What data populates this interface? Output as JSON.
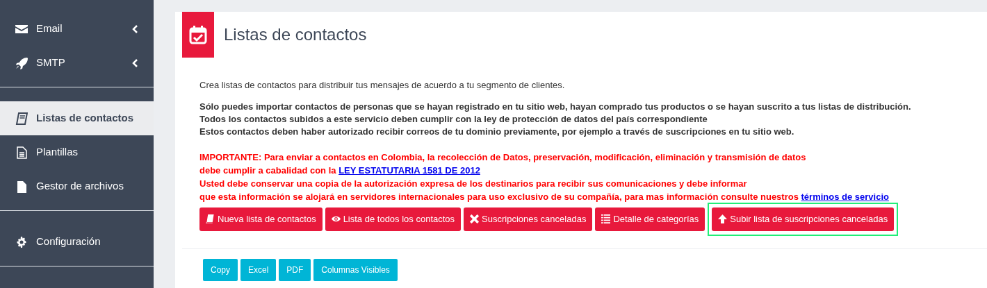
{
  "sidebar": {
    "groups": [
      {
        "items": [
          {
            "label": "Email",
            "selected": false,
            "expandable": true
          },
          {
            "label": "SMTP",
            "selected": false,
            "expandable": true
          }
        ]
      },
      {
        "items": [
          {
            "label": "Listas de contactos",
            "selected": true,
            "expandable": false
          },
          {
            "label": "Plantillas",
            "selected": false,
            "expandable": false
          },
          {
            "label": "Gestor de archivos",
            "selected": false,
            "expandable": false
          }
        ]
      },
      {
        "items": [
          {
            "label": "Configuración",
            "selected": false,
            "expandable": false
          }
        ]
      }
    ]
  },
  "page": {
    "title": "Listas de contactos",
    "intro": "Crea listas de contactos para distribuir tus mensajes de acuerdo a tu segmento de clientes.",
    "rules": [
      "Sólo puedes importar contactos de personas que se hayan registrado en tu sitio web, hayan comprado tus productos o se hayan suscrito a tus listas de distribución.",
      "Todos los contactos subidos a este servicio deben cumplir con la ley de protección de datos del país correspondiente",
      "Estos contactos deben haber autorizado recibir correos de tu dominio previamente, por ejemplo a través de suscripciones en tu sitio web."
    ],
    "notice": [
      [
        {
          "kind": "text",
          "text": "IMPORTANTE: Para enviar a contactos en Colombia, la recolección de Datos, preservación, modificación, eliminación y transmisión de datos"
        }
      ],
      [
        {
          "kind": "text",
          "text": "debe cumplir a cabalidad con la "
        },
        {
          "kind": "link",
          "text": "LEY ESTATUTARIA 1581 DE 2012"
        }
      ],
      [
        {
          "kind": "text",
          "text": "Usted debe conservar una copia de la autorización expresa de los destinarios para recibir sus comunicaciones y debe informar"
        }
      ],
      [
        {
          "kind": "text",
          "text": "que esta información se alojará en servidores internacionales para uso exclusivo de su compañía, para mas información consulte nuestros "
        },
        {
          "kind": "link",
          "text": "términos de servicio"
        }
      ]
    ],
    "actions": [
      {
        "label": "Nueva lista de contactos",
        "highlighted": false
      },
      {
        "label": "Lista de todos los contactos",
        "highlighted": false
      },
      {
        "label": "Suscripciones canceladas",
        "highlighted": false
      },
      {
        "label": "Detalle de categorías",
        "highlighted": false
      },
      {
        "label": "Subir lista de suscripciones canceladas",
        "highlighted": true
      }
    ],
    "export_buttons": [
      "Copy",
      "Excel",
      "PDF",
      "Columnas Visibles"
    ]
  }
}
